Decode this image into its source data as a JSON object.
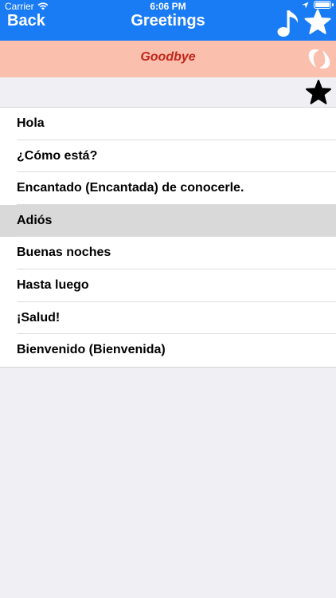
{
  "status_bar": {
    "carrier": "Carrier",
    "time": "6:06 PM"
  },
  "nav": {
    "back_label": "Back",
    "title": "Greetings",
    "music_icon": "music-note-icon",
    "favorite_icon": "star-outline-icon"
  },
  "banner": {
    "translation": "Goodbye",
    "logo_icon": "app-logo-icon",
    "background": "#fbbfae",
    "text_color": "#c0261a"
  },
  "strip": {
    "star_icon": "star-filled-icon"
  },
  "phrases": [
    {
      "text": "Hola",
      "selected": false
    },
    {
      "text": "¿Cómo está?",
      "selected": false
    },
    {
      "text": "Encantado (Encantada) de conocerle.",
      "selected": false
    },
    {
      "text": "Adiós",
      "selected": true
    },
    {
      "text": "Buenas noches",
      "selected": false
    },
    {
      "text": "Hasta luego",
      "selected": false
    },
    {
      "text": "¡Salud!",
      "selected": false
    },
    {
      "text": "Bienvenido (Bienvenida)",
      "selected": false
    }
  ],
  "colors": {
    "nav_blue": "#1a7cf5",
    "background": "#efeff4",
    "selected_row": "#d9d9d9"
  }
}
